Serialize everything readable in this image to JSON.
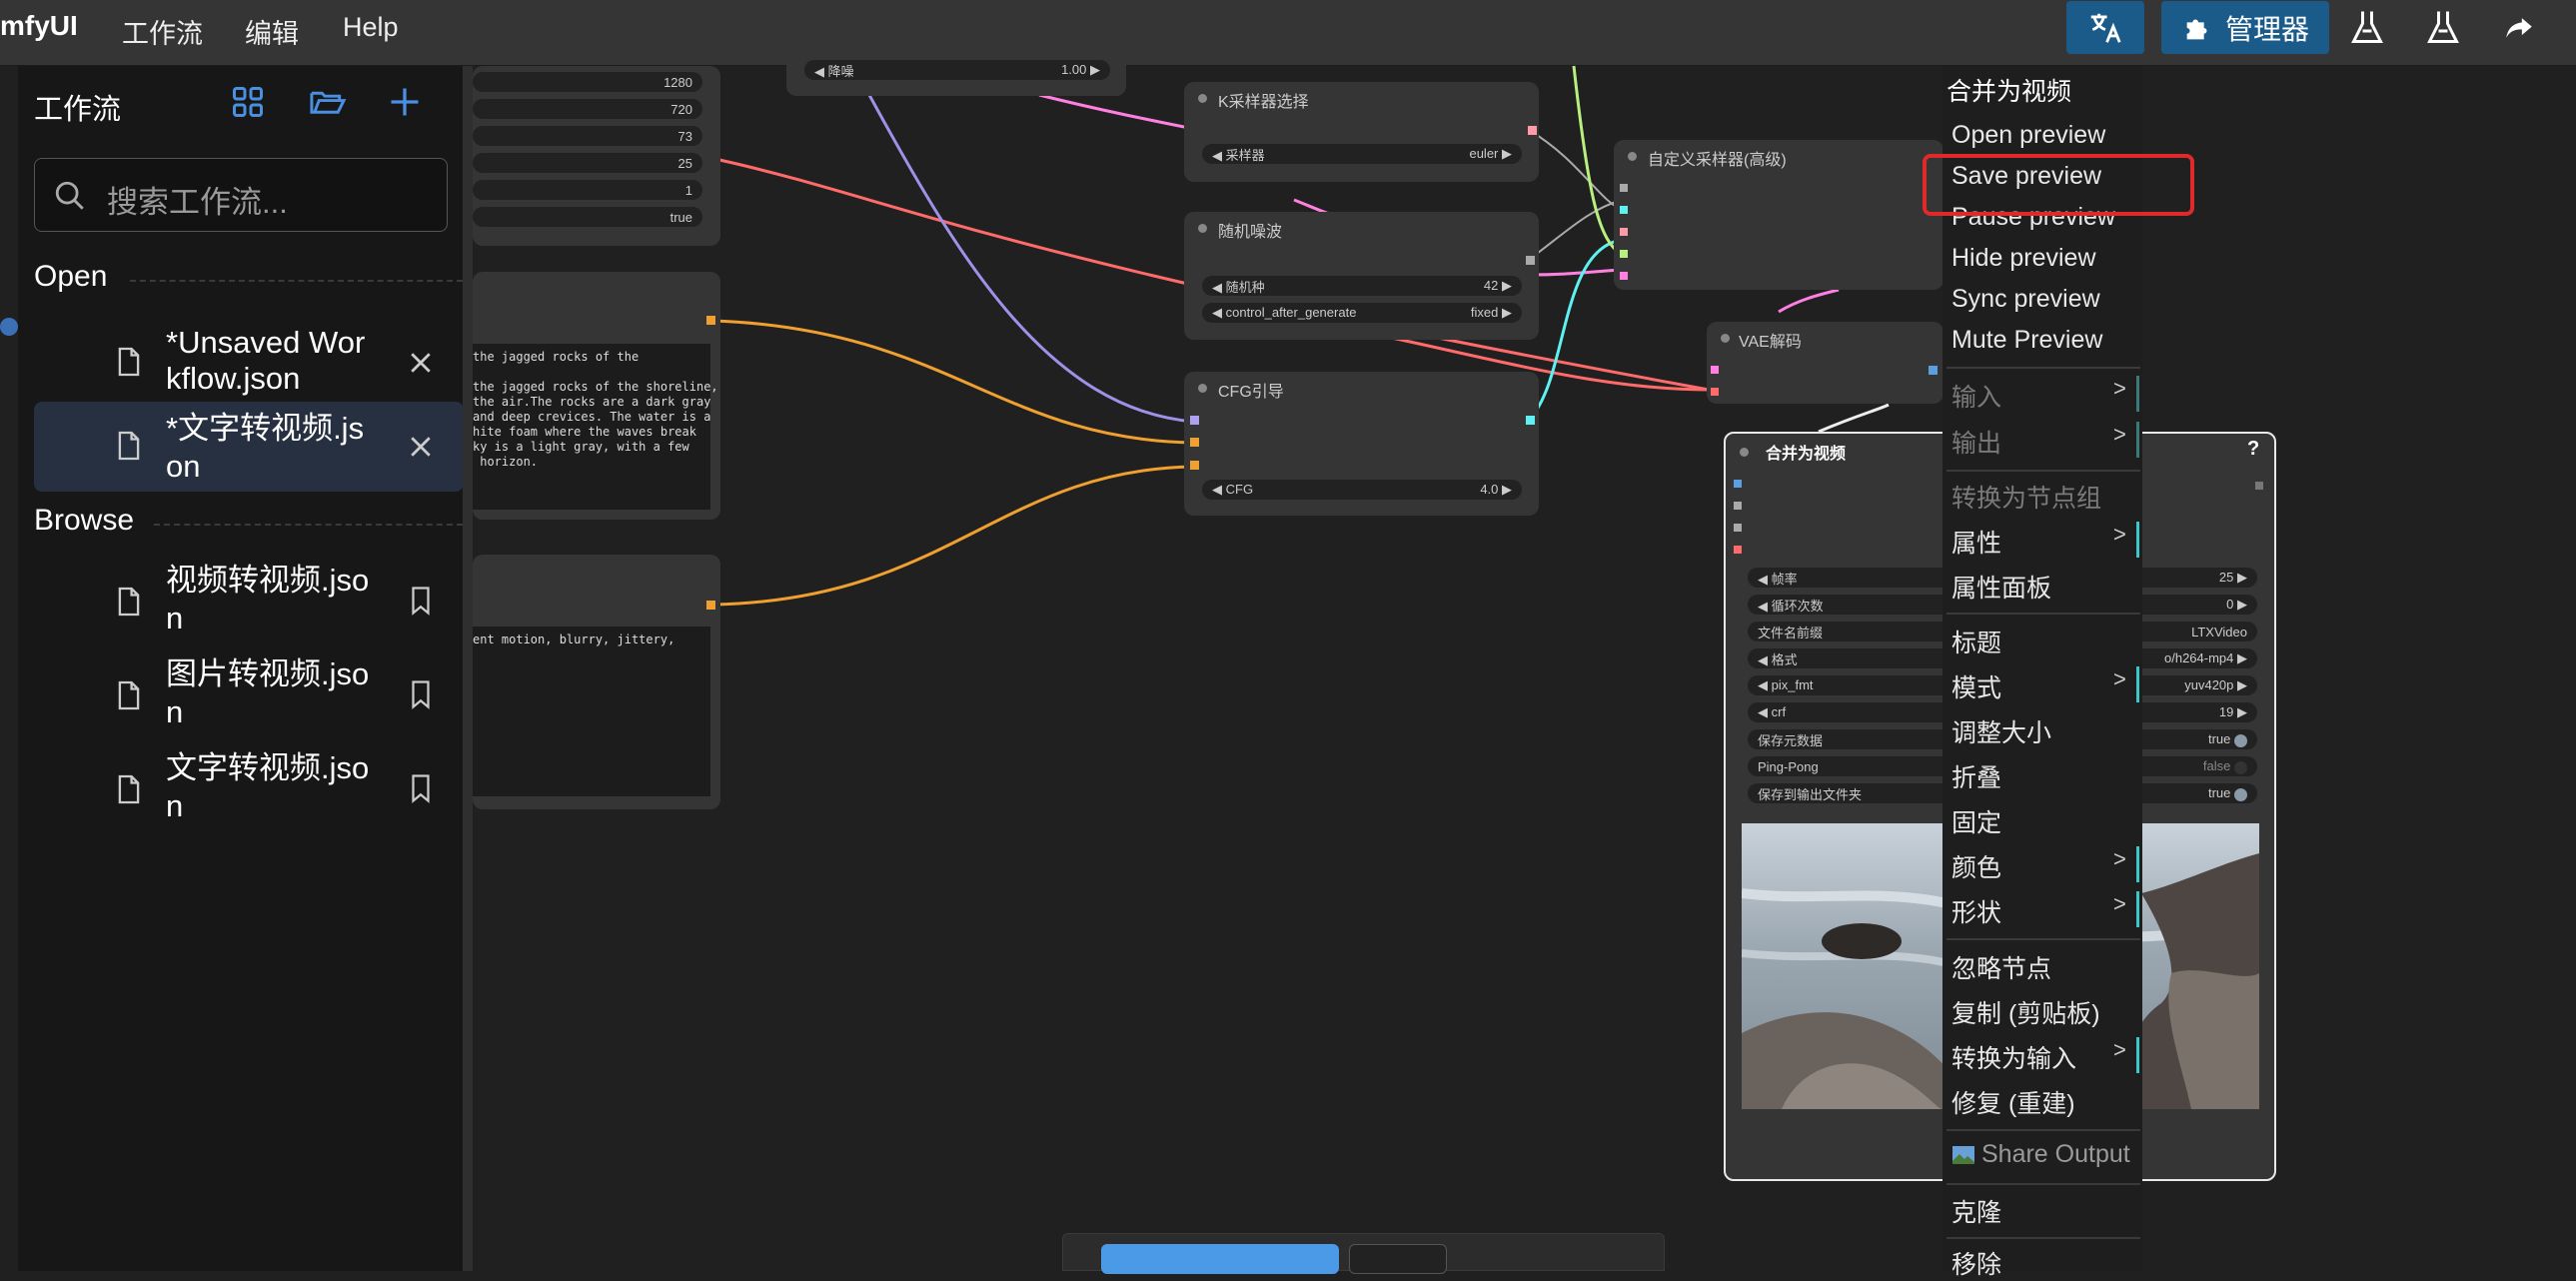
{
  "app": {
    "brand": "mfyUI"
  },
  "menubar": {
    "workflow": "工作流",
    "edit": "编辑",
    "help": "Help"
  },
  "toolbar": {
    "manager": "管理器"
  },
  "sidebar": {
    "title": "工作流",
    "search_placeholder": "搜索工作流...",
    "open_label": "Open",
    "open_items": [
      {
        "line1": "*Unsaved Wor",
        "line2": "kflow.json"
      },
      {
        "line1": "*文字转视频.js",
        "line2": "on"
      }
    ],
    "browse_label": "Browse",
    "browse_items": [
      {
        "line1": "视频转视频.jso",
        "line2": "n"
      },
      {
        "line1": "图片转视频.jso",
        "line2": "n"
      },
      {
        "line1": "文字转视频.jso",
        "line2": "n"
      }
    ]
  },
  "nodes": {
    "left_widgets": [
      "1280",
      "720",
      "73",
      "25",
      "1",
      "true"
    ],
    "prompt_text": "the jagged rocks of the\n\nthe jagged rocks of the shoreline,\nthe air.The rocks are a dark gray\nand deep crevices. The water is a\nhite foam where the waves break\nky is a light gray, with a few\n horizon.",
    "neg_text": "ent motion, blurry, jittery,",
    "denoise": {
      "label": "降噪",
      "value": "1.00"
    },
    "ksampler_select": {
      "title": "K采样器选择",
      "label": "采样器",
      "value": "euler"
    },
    "random_noise": {
      "title": "随机噪波",
      "seed_label": "随机种",
      "seed_value": "42",
      "cag_label": "control_after_generate",
      "cag_value": "fixed"
    },
    "cfg_guide": {
      "title": "CFG引导",
      "label": "CFG",
      "value": "4.0"
    },
    "custom_sampler": {
      "title": "自定义采样器(高级)"
    },
    "vae_decode": {
      "title": "VAE解码"
    },
    "combine_video": {
      "title": "合并为视频",
      "help": "?",
      "widgets": [
        {
          "label": "帧率",
          "value": "25"
        },
        {
          "label": "循环次数",
          "value": "0"
        },
        {
          "label": "文件名前缀",
          "value": "LTXVideo"
        },
        {
          "label": "格式",
          "value": "o/h264-mp4"
        },
        {
          "label": "pix_fmt",
          "value": "yuv420p"
        },
        {
          "label": "crf",
          "value": "19"
        },
        {
          "label": "保存元数据",
          "value": "true"
        },
        {
          "label": "Ping-Pong",
          "value": "false"
        },
        {
          "label": "保存到输出文件夹",
          "value": "true"
        }
      ]
    }
  },
  "context_menu": {
    "header": "合并为视频",
    "items": {
      "open_preview": "Open preview",
      "save_preview": "Save preview",
      "pause_preview": "Pause preview",
      "hide_preview": "Hide preview",
      "sync_preview": "Sync preview",
      "mute_preview": "Mute Preview",
      "input": "输入",
      "output": "输出",
      "convert_group": "转换为节点组",
      "properties": "属性",
      "properties_panel": "属性面板",
      "title": "标题",
      "mode": "模式",
      "resize": "调整大小",
      "collapse": "折叠",
      "pin": "固定",
      "color": "颜色",
      "shape": "形状",
      "bypass": "忽略节点",
      "copy_clipboard": "复制 (剪贴板)",
      "convert_input": "转换为输入",
      "fix_rebuild": "修复 (重建)",
      "share_output": "Share Output",
      "clone": "克隆",
      "remove": "移除"
    },
    "arrow": ">"
  },
  "colors": {
    "accent_blue": "#1a5b8a",
    "highlight_red": "#e0292b",
    "link_orange": "#f0a030",
    "link_red": "#ff6b6b",
    "link_pink": "#ff80e0",
    "link_cyan": "#5ff0f0"
  }
}
